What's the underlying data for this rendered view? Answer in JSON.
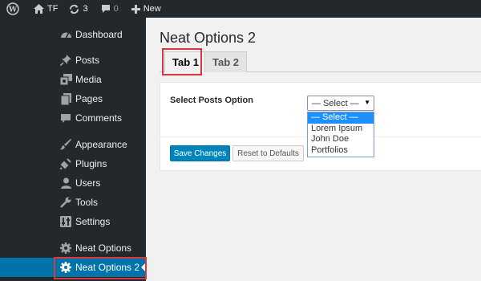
{
  "colors": {
    "adminbar_bg": "#23282d",
    "sidebar_bg": "#23282d",
    "current_menu_bg": "#0073aa",
    "highlight_outline": "#d9363e",
    "primary_button": "#0085ba",
    "dropdown_selected": "#1e90ff"
  },
  "adminbar": {
    "site_name": "TF",
    "updates_count": "3",
    "comments_count": "0",
    "new_label": "New",
    "icons": [
      "wordpress-icon",
      "home-icon",
      "updates-icon",
      "comment-icon",
      "plus-icon"
    ]
  },
  "sidebar": {
    "items": [
      {
        "label": "Dashboard",
        "icon": "dashboard-icon"
      },
      {
        "label": "Posts",
        "icon": "pin-icon"
      },
      {
        "label": "Media",
        "icon": "media-icon"
      },
      {
        "label": "Pages",
        "icon": "pages-icon"
      },
      {
        "label": "Comments",
        "icon": "comment-icon"
      },
      {
        "label": "Appearance",
        "icon": "brush-icon"
      },
      {
        "label": "Plugins",
        "icon": "plug-icon"
      },
      {
        "label": "Users",
        "icon": "user-icon"
      },
      {
        "label": "Tools",
        "icon": "wrench-icon"
      },
      {
        "label": "Settings",
        "icon": "settings-icon"
      },
      {
        "label": "Neat Options",
        "icon": "gear-icon"
      },
      {
        "label": "Neat Options 2",
        "icon": "gear-icon",
        "current": true
      }
    ]
  },
  "main": {
    "title": "Neat Options 2",
    "tabs": [
      {
        "label": "Tab 1",
        "active": true
      },
      {
        "label": "Tab 2",
        "active": false
      }
    ],
    "field": {
      "label": "Select Posts Option",
      "selected": "— Select —",
      "options": [
        "— Select —",
        "Lorem Ipsum",
        "John Doe",
        "Portfolios"
      ]
    },
    "buttons": {
      "save": "Save Changes",
      "reset": "Reset to Defaults"
    }
  }
}
